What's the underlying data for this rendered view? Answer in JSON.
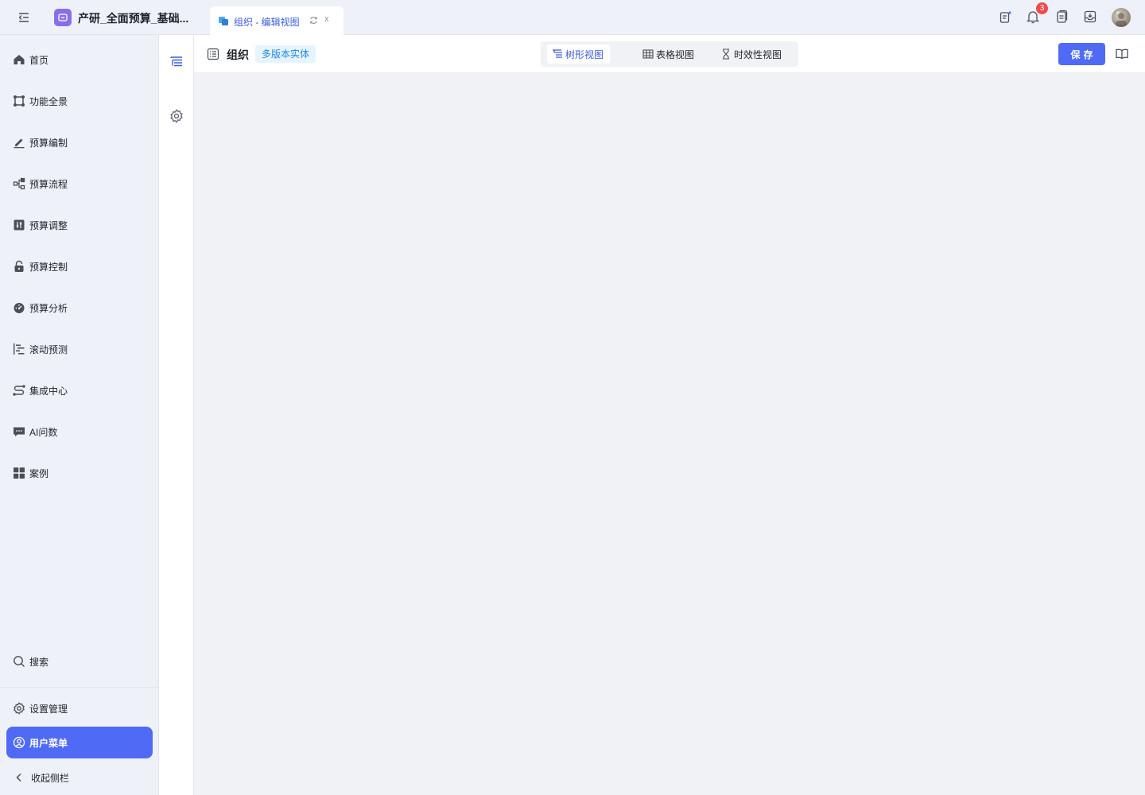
{
  "app": {
    "title": "产研_全面预算_基础..."
  },
  "tab": {
    "label": "组织 - 编辑视图",
    "close": "x"
  },
  "notifications": {
    "count": "3"
  },
  "sidebar": {
    "items": [
      {
        "label": "首页",
        "icon": "home-icon"
      },
      {
        "label": "功能全景",
        "icon": "overview-icon"
      },
      {
        "label": "预算编制",
        "icon": "edit-icon"
      },
      {
        "label": "预算流程",
        "icon": "flow-icon"
      },
      {
        "label": "预算调整",
        "icon": "adjust-icon"
      },
      {
        "label": "预算控制",
        "icon": "lock-icon"
      },
      {
        "label": "预算分析",
        "icon": "dashboard-icon"
      },
      {
        "label": "滚动预测",
        "icon": "forecast-icon"
      },
      {
        "label": "集成中心",
        "icon": "integration-icon"
      },
      {
        "label": "AI问数",
        "icon": "chat-icon"
      },
      {
        "label": "案例",
        "icon": "grid-icon"
      }
    ],
    "search": "搜索",
    "settings": "设置管理",
    "user_menu": "用户菜单",
    "collapse": "收起侧栏"
  },
  "header": {
    "title": "组织",
    "tag": "多版本实体",
    "views": [
      {
        "label": "树形视图",
        "active": true
      },
      {
        "label": "表格视图",
        "active": false
      },
      {
        "label": "时效性视图",
        "active": false
      }
    ],
    "save": "保存"
  },
  "colors": {
    "primary": "#4f6bf5",
    "tag_bg": "#e6f4ff",
    "tag_text": "#1e88e5",
    "badge": "#f04a4a"
  }
}
